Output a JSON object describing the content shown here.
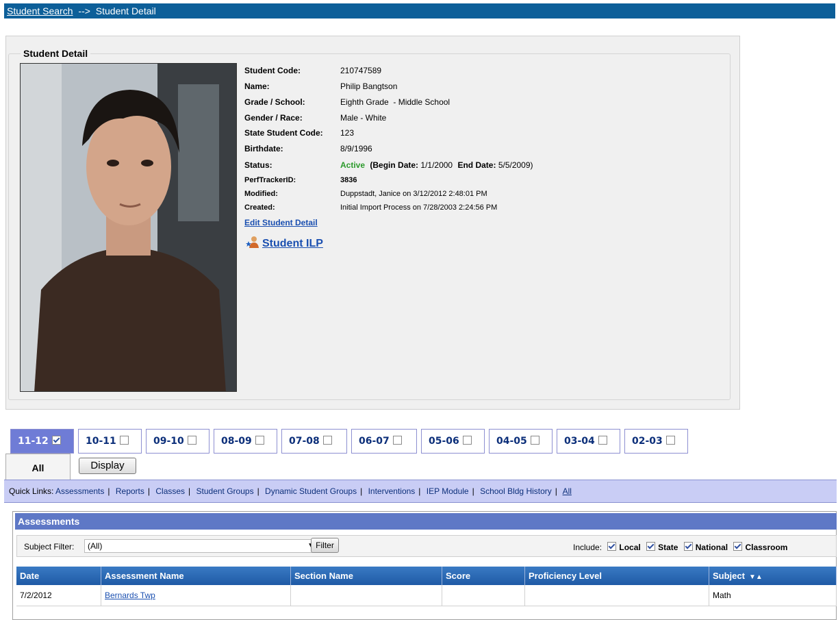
{
  "breadcrumb": {
    "link": "Student Search",
    "arrow": "-->",
    "current": "Student Detail"
  },
  "detail": {
    "legend": "Student Detail",
    "fields": [
      {
        "label": "Student Code:",
        "value": "210747589"
      },
      {
        "label": "Name:",
        "value": "Philip Bangtson"
      },
      {
        "label": "Grade / School:",
        "value": "Eighth Grade  - Middle School"
      },
      {
        "label": "Gender / Race:",
        "value": "Male - White"
      },
      {
        "label": "State Student Code:",
        "value": "123"
      },
      {
        "label": "Birthdate:",
        "value": "8/9/1996"
      }
    ],
    "status": {
      "label": "Status:",
      "value": "Active",
      "begin_label": "(Begin Date:",
      "begin": "1/1/2000",
      "end_label": "End Date:",
      "end": "5/5/2009)"
    },
    "perf": {
      "label": "PerfTrackerID:",
      "value": "3836"
    },
    "modified": {
      "label": "Modified:",
      "value": "Duppstadt, Janice on 3/12/2012 2:48:01 PM"
    },
    "created": {
      "label": "Created:",
      "value": "Initial Import Process on 7/28/2003 2:24:56 PM"
    },
    "edit_link": "Edit Student Detail",
    "ilp_link": "Student ILP",
    "ilp_icon": "person-star-icon"
  },
  "year_tabs": [
    {
      "label": "11-12",
      "checked": true
    },
    {
      "label": "10-11",
      "checked": false
    },
    {
      "label": "09-10",
      "checked": false
    },
    {
      "label": "08-09",
      "checked": false
    },
    {
      "label": "07-08",
      "checked": false
    },
    {
      "label": "06-07",
      "checked": false
    },
    {
      "label": "05-06",
      "checked": false
    },
    {
      "label": "04-05",
      "checked": false
    },
    {
      "label": "03-04",
      "checked": false
    },
    {
      "label": "02-03",
      "checked": false
    }
  ],
  "all_tab": "All",
  "display_button": "Display",
  "quick_links": {
    "prefix": "Quick Links:",
    "items": [
      "Assessments",
      "Reports",
      "Classes",
      "Student Groups",
      "Dynamic Student Groups",
      "Interventions",
      "IEP Module",
      "School Bldg History",
      "All"
    ]
  },
  "assessments": {
    "title": "Assessments",
    "subject_filter_label": "Subject Filter:",
    "subject_filter_value": "(All)",
    "filter_button": "Filter",
    "include_label": "Include:",
    "include_options": [
      {
        "label": "Local",
        "checked": true
      },
      {
        "label": "State",
        "checked": true
      },
      {
        "label": "National",
        "checked": true
      },
      {
        "label": "Classroom",
        "checked": true
      }
    ],
    "columns": [
      "Date",
      "Assessment Name",
      "Section Name",
      "Score",
      "Proficiency Level",
      "Subject"
    ],
    "rows": [
      {
        "date": "7/2/2012",
        "name": "Bernards Twp",
        "section": "",
        "score": "",
        "proficiency": "",
        "subject": "Math"
      }
    ]
  },
  "colors": {
    "topbar": "#0d5f99",
    "active_tab": "#6f7cd6",
    "quicklinks_bg": "#c9cdf5",
    "assessment_header": "#5e78c6",
    "status_active": "#2b9a2b"
  }
}
